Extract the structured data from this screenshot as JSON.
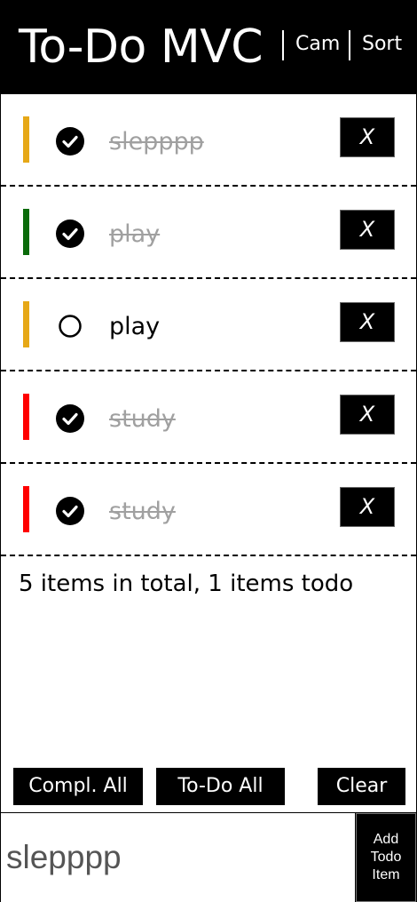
{
  "header": {
    "title": "To-Do MVC",
    "cam_label": "Cam",
    "sort_label": "Sort"
  },
  "todos": [
    {
      "text": "slepppp",
      "completed": true,
      "priority_color": "#e6a817",
      "delete_label": "X"
    },
    {
      "text": "play",
      "completed": true,
      "priority_color": "#0a6b0a",
      "delete_label": "X"
    },
    {
      "text": "play",
      "completed": false,
      "priority_color": "#e6a817",
      "delete_label": "X"
    },
    {
      "text": "study",
      "completed": true,
      "priority_color": "#ff0000",
      "delete_label": "X"
    },
    {
      "text": "study",
      "completed": true,
      "priority_color": "#ff0000",
      "delete_label": "X"
    }
  ],
  "summary": "5 items in total, 1 items todo",
  "footer": {
    "complete_all_label": "Compl. All",
    "todo_all_label": "To-Do All",
    "clear_label": "Clear"
  },
  "new_todo": {
    "value": "slepppp",
    "add_label_line1": "Add",
    "add_label_line2": "Todo",
    "add_label_line3": "Item"
  },
  "icons": {
    "checked": "check-circle-filled",
    "unchecked": "circle-outline"
  }
}
